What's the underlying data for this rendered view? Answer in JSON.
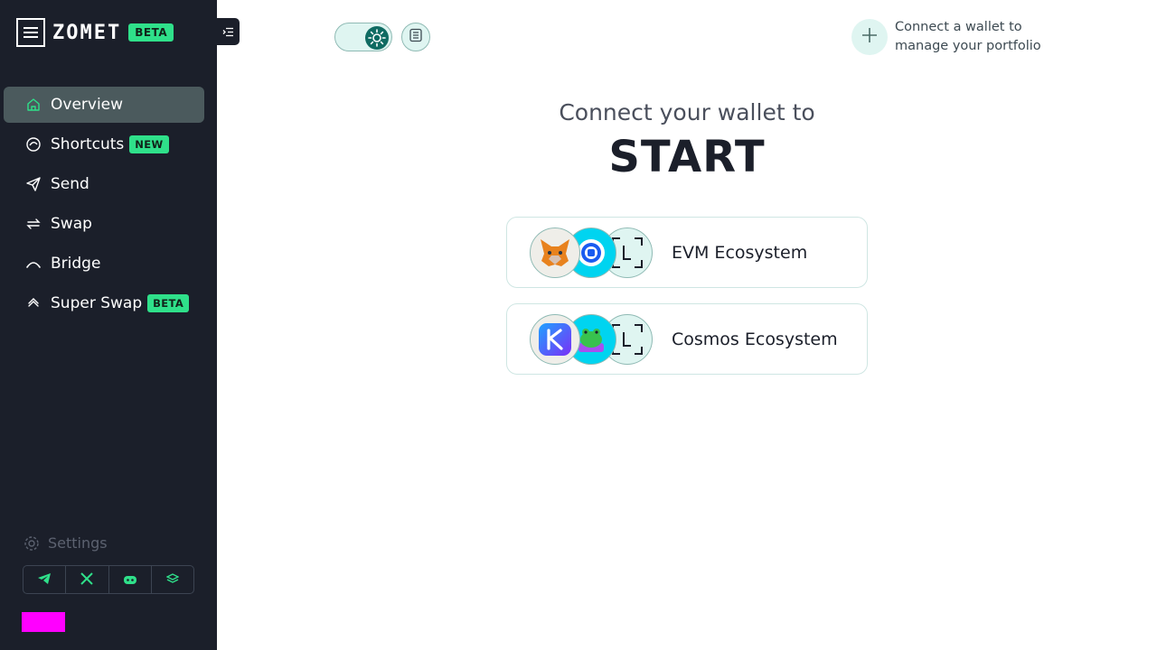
{
  "brand": {
    "name": "ZOMET",
    "badge": "BETA"
  },
  "nav": {
    "items": [
      {
        "label": "Overview",
        "icon": "home-icon",
        "active": true,
        "badge": ""
      },
      {
        "label": "Shortcuts",
        "icon": "shortcuts-icon",
        "active": false,
        "badge": "NEW"
      },
      {
        "label": "Send",
        "icon": "send-icon",
        "active": false,
        "badge": ""
      },
      {
        "label": "Swap",
        "icon": "swap-icon",
        "active": false,
        "badge": ""
      },
      {
        "label": "Bridge",
        "icon": "bridge-icon",
        "active": false,
        "badge": ""
      },
      {
        "label": "Super Swap",
        "icon": "super-swap-icon",
        "active": false,
        "badge": "BETA"
      }
    ]
  },
  "footer": {
    "settings_label": "Settings",
    "socials": [
      "telegram-icon",
      "x-icon",
      "discord-icon",
      "docs-icon"
    ]
  },
  "topbar": {
    "theme": "light",
    "connect_text": "Connect a wallet to manage your portfolio"
  },
  "main": {
    "headline": "Connect your wallet to",
    "emphasis": "START",
    "ecosystems": [
      {
        "label": "EVM Ecosystem",
        "wallets": [
          "metamask-icon",
          "wallet-connect-icon",
          "ledger-icon"
        ]
      },
      {
        "label": "Cosmos Ecosystem",
        "wallets": [
          "keplr-icon",
          "leap-icon",
          "ledger-icon"
        ]
      }
    ]
  },
  "colors": {
    "sidebar_bg": "#1b1f2a",
    "accent": "#2fe08a",
    "active_item": "#4b5a5d",
    "teal": "#0f6b62",
    "mint": "#dff5f1"
  }
}
